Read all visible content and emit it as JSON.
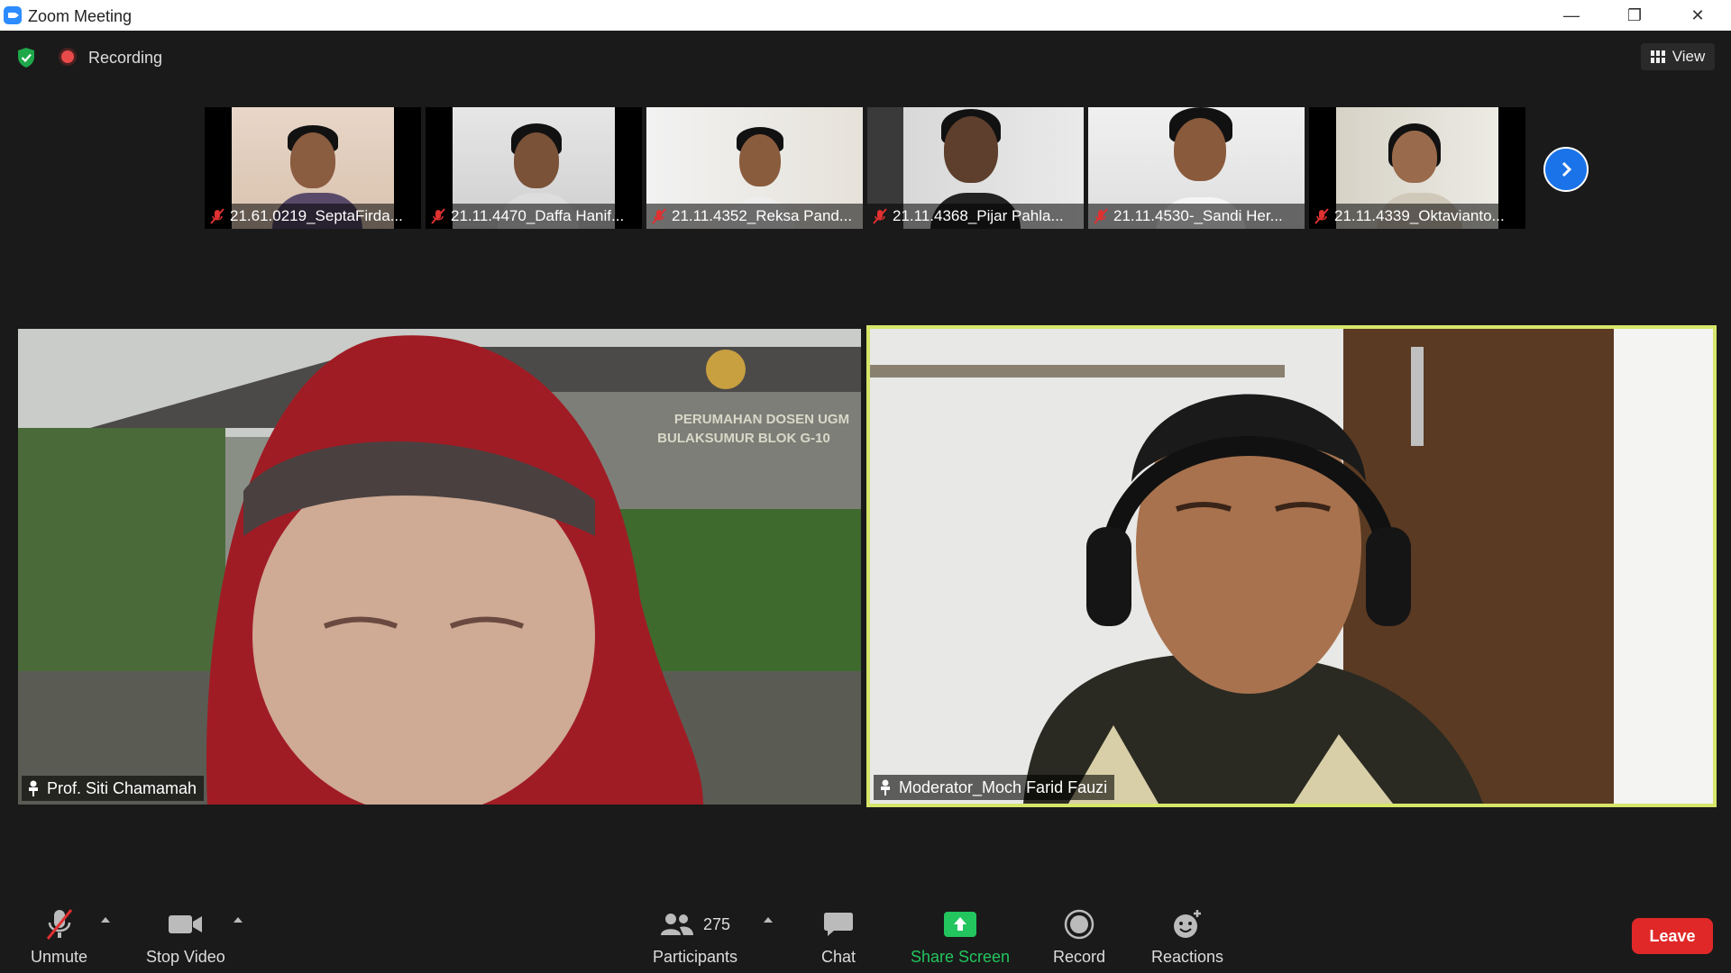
{
  "window": {
    "title": "Zoom Meeting",
    "minimize_glyph": "—",
    "maximize_glyph": "❐",
    "close_glyph": "✕"
  },
  "status": {
    "recording_label": "Recording",
    "view_label": "View"
  },
  "thumbnails": [
    {
      "name": "21.61.0219_SeptaFirda..."
    },
    {
      "name": "21.11.4470_Daffa Hanif..."
    },
    {
      "name": "21.11.4352_Reksa Pand..."
    },
    {
      "name": "21.11.4368_Pijar Pahla..."
    },
    {
      "name": "21.11.4530-_Sandi Her..."
    },
    {
      "name": "21.11.4339_Oktavianto..."
    }
  ],
  "main_tiles": {
    "left": {
      "name": "Prof. Siti Chamamah",
      "sign_line1": "PERUMAHAN DOSEN UGM",
      "sign_line2": "BULAKSUMUR BLOK G-10"
    },
    "right": {
      "name": "Moderator_Moch Farid Fauzi"
    }
  },
  "toolbar": {
    "unmute_label": "Unmute",
    "stop_video_label": "Stop Video",
    "participants_label": "Participants",
    "participants_count": "275",
    "chat_label": "Chat",
    "share_screen_label": "Share Screen",
    "record_label": "Record",
    "reactions_label": "Reactions",
    "leave_label": "Leave"
  },
  "colors": {
    "accent_blue": "#1a73e8",
    "share_green": "#22c55e",
    "leave_red": "#e02828",
    "active_speaker_border": "#d7e66a"
  }
}
